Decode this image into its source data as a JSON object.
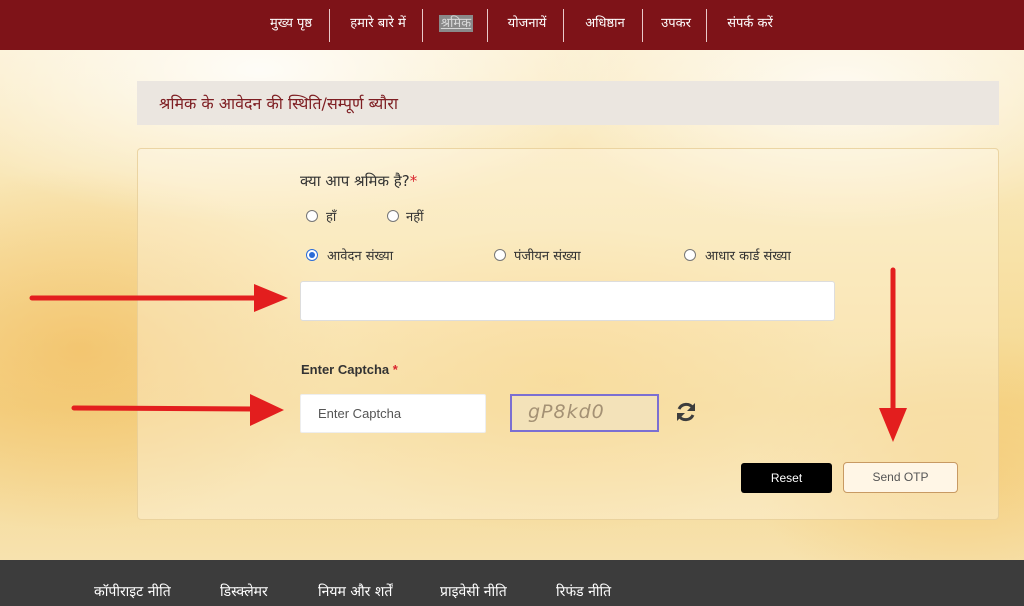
{
  "nav": {
    "items": [
      "मुख्य पृष्ठ",
      "हमारे बारे में",
      "श्रमिक",
      "योजनायें",
      "अधिष्ठान",
      "उपकर",
      "संपर्क करें"
    ]
  },
  "page": {
    "heading": "श्रमिक के आवेदन की स्थिति/सम्पूर्ण ब्यौरा"
  },
  "form": {
    "question": "क्या आप श्रमिक है?",
    "required_mark": "*",
    "yes_no": [
      {
        "label": "हाँ",
        "checked": false
      },
      {
        "label": "नहीं",
        "checked": false
      }
    ],
    "search_types": [
      {
        "label": "आवेदन संख्या",
        "checked": true
      },
      {
        "label": "पंजीयन संख्या",
        "checked": false
      },
      {
        "label": "आधार कार्ड संख्या",
        "checked": false
      }
    ],
    "number_value": "",
    "captcha_label": "Enter Captcha",
    "captcha_placeholder": "Enter Captcha",
    "captcha_text": "gP8kd0",
    "reset_label": "Reset",
    "send_otp_label": "Send OTP"
  },
  "footer": {
    "links": [
      "कॉपीराइट नीति",
      "डिस्क्लेमर",
      "नियम और शर्तें",
      "प्राइवेसी नीति",
      "रिफंड नीति"
    ]
  },
  "colors": {
    "nav_bg": "#7e1318",
    "heading_text": "#7e1e22",
    "annotation_arrow": "#e31e1e",
    "footer_bg": "#3c3c3c"
  }
}
